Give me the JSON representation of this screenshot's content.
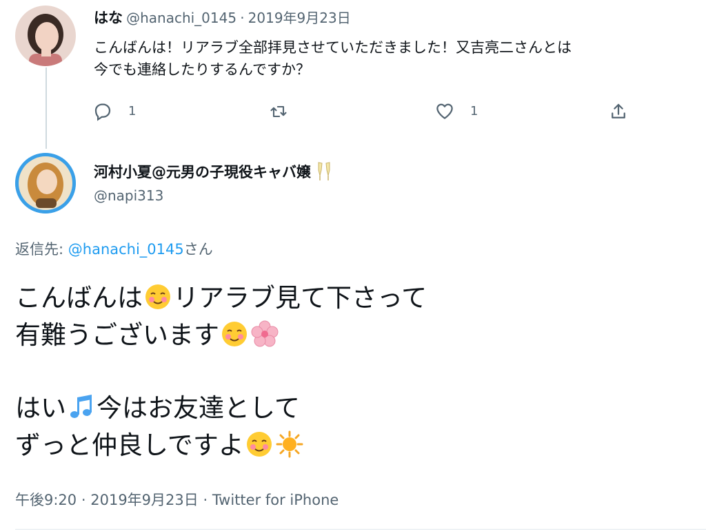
{
  "first_tweet": {
    "display_name": "はな",
    "handle": "@hanachi_0145",
    "separator": "·",
    "date": "2019年9月23日",
    "lines": [
      "こんばんは！リアラブ全部拝見させていただきました！又吉亮二さんとは",
      "今でも連絡したりするんですか？"
    ],
    "reply_count": "1",
    "like_count": "1"
  },
  "second_tweet": {
    "display_name": "河村小夏@元男の子現役キャバ嬢",
    "handle": "@napi313",
    "reply_to_label": "返信先:",
    "reply_to_handle": "@hanachi_0145",
    "reply_to_suffix": "さん",
    "line1_a": "こんばんは",
    "line1_b": "リアラブ見て下さって",
    "line2": "有難うございます",
    "line3_a": "はい",
    "line3_b": "今はお友達として",
    "line4": "ずっと仲良しですよ",
    "time": "午後9:20",
    "date": "2019年9月23日",
    "source": "Twitter for iPhone",
    "separator": "·"
  },
  "icons": [
    "reply-icon",
    "retweet-icon",
    "like-icon",
    "share-icon",
    "smiling-face-emoji",
    "cherry-blossom-emoji",
    "music-notes-emoji",
    "sun-emoji",
    "champagne-emoji"
  ],
  "colors": {
    "link": "#1d9bf0",
    "secondary": "#536471",
    "primary": "#0f1419"
  }
}
